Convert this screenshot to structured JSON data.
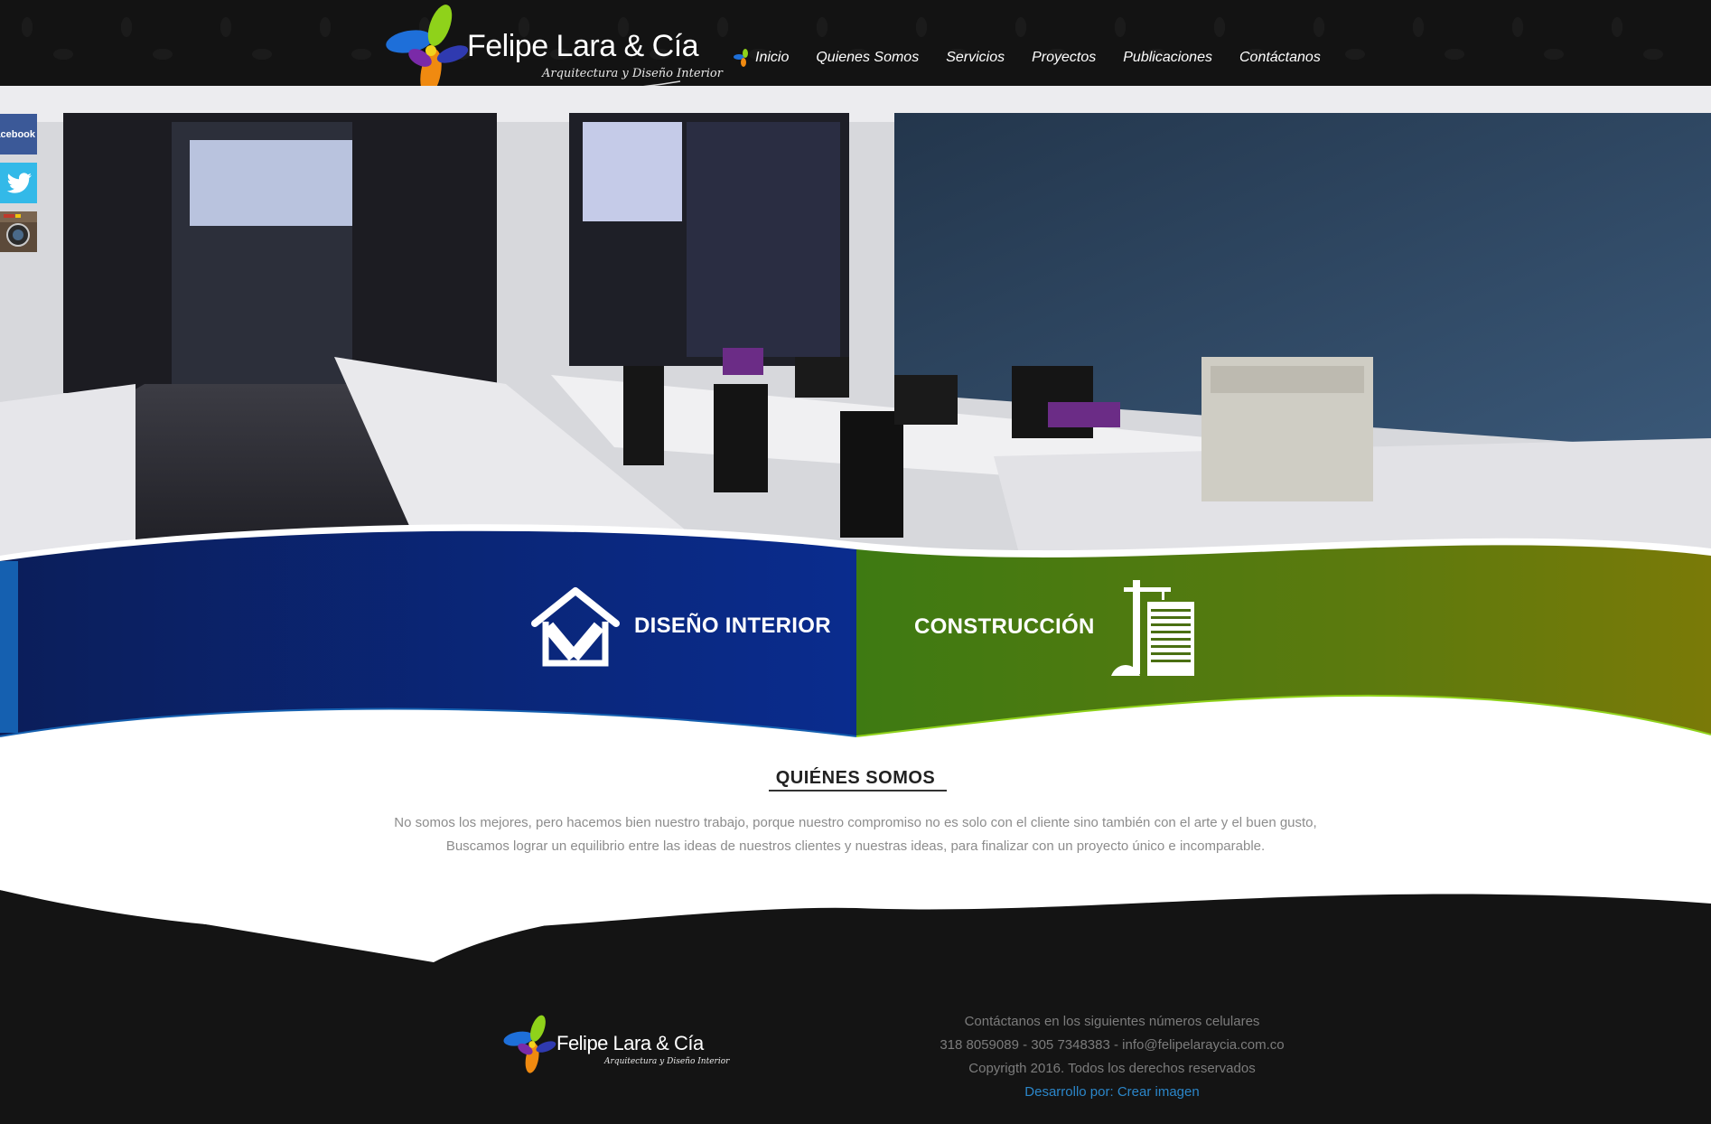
{
  "header": {
    "logo_title": "Felipe Lara & Cía",
    "logo_subtitle": "Arquitectura y Diseño Interior",
    "nav": [
      {
        "label": "Inicio"
      },
      {
        "label": "Quienes Somos"
      },
      {
        "label": "Servicios"
      },
      {
        "label": "Proyectos"
      },
      {
        "label": "Publicaciones"
      },
      {
        "label": "Contáctanos"
      }
    ]
  },
  "social": {
    "facebook_label": "facebook"
  },
  "services": {
    "interior_label": "DISEÑO INTERIOR",
    "construction_label": "CONSTRUCCIÓN"
  },
  "about": {
    "title": "QUIÉNES SOMOS",
    "line1": "No somos los mejores, pero hacemos bien nuestro trabajo, porque nuestro compromiso no es solo con el cliente sino también con el arte y el buen gusto,",
    "line2": "Buscamos lograr un equilibrio entre las ideas de nuestros clientes y nuestras ideas, para finalizar con un proyecto único e incomparable."
  },
  "footer": {
    "logo_title": "Felipe Lara & Cía",
    "logo_subtitle": "Arquitectura y Diseño Interior",
    "contact_intro": "Contáctanos en los siguientes números celulares",
    "contact_line": "318 8059089 - 305 7348383 - info@felipelaraycia.com.co",
    "copyright": "Copyrigth 2016. Todos los derechos reservados",
    "credit": "Desarrollo por: Crear imagen"
  },
  "colors": {
    "background": "#141414",
    "interior_blue": "#0a2a8a",
    "construction_green": "#4f8a10",
    "link_blue": "#2b86c9"
  }
}
